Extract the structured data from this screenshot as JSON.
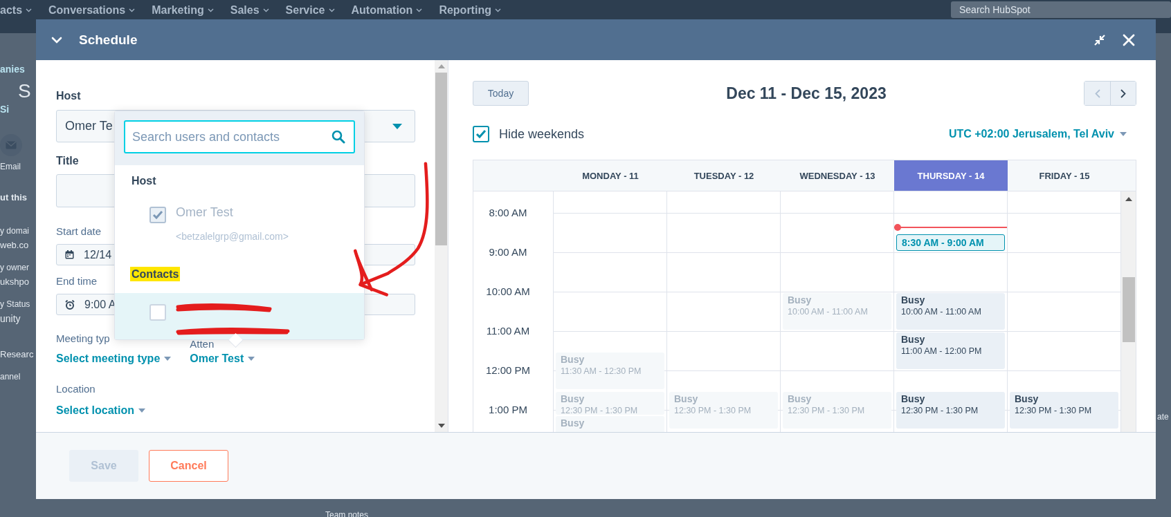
{
  "background": {
    "nav_items": [
      "acts",
      "Conversations",
      "Marketing",
      "Sales",
      "Service",
      "Automation",
      "Reporting"
    ],
    "search": {
      "placeholder": "Search HubSpot"
    },
    "left_items": [
      {
        "kind": "link",
        "text": "anies"
      },
      {
        "kind": "big",
        "text": "S"
      },
      {
        "kind": "link",
        "text": "Si"
      },
      {
        "kind": "email-icon"
      },
      {
        "kind": "label",
        "text": "Email"
      },
      {
        "kind": "heading",
        "text": "ut this"
      },
      {
        "kind": "label",
        "text": "y domai"
      },
      {
        "kind": "value",
        "text": "web.co"
      },
      {
        "kind": "label",
        "text": "y owner"
      },
      {
        "kind": "value",
        "text": "ukshpo"
      },
      {
        "kind": "label",
        "text": "y Status"
      },
      {
        "kind": "select",
        "text": "unity"
      },
      {
        "kind": "value",
        "text": "Researc"
      },
      {
        "kind": "label",
        "text": "annel"
      }
    ],
    "right_items": [
      "ate"
    ],
    "bottom_items": [
      "Team notes"
    ]
  },
  "modal": {
    "title": "Schedule",
    "form": {
      "host": {
        "label": "Host",
        "value": "Omer Te"
      },
      "title": {
        "label": "Title"
      },
      "start_date": {
        "label": "Start date",
        "value": "12/14"
      },
      "end_time": {
        "label": "End time",
        "value": "9:00 A"
      },
      "meeting_type": {
        "label": "Meeting typ",
        "value": "Select meeting type"
      },
      "attendees": {
        "label": "Atten",
        "value": "Omer Test"
      },
      "location": {
        "label": "Location",
        "value": "Select location"
      }
    },
    "picker": {
      "search": {
        "placeholder": "Search users and contacts"
      },
      "sections": [
        {
          "heading": "Host",
          "highlighted": false,
          "items": [
            {
              "name": "Omer Test",
              "email": "<betzalelgrp@gmail.com>",
              "checked": true,
              "disabled": true,
              "hovered": false,
              "redacted": false
            }
          ]
        },
        {
          "heading": "Contacts",
          "highlighted": true,
          "items": [
            {
              "checked": false,
              "disabled": false,
              "hovered": true,
              "redacted": true
            }
          ]
        }
      ]
    },
    "calendar": {
      "today_button": "Today",
      "range": "Dec 11 - Dec 15, 2023",
      "hide_weekends": {
        "label": "Hide weekends",
        "checked": true
      },
      "timezone": "UTC +02:00 Jerusalem, Tel Aviv",
      "hours": [
        "8:00 AM",
        "9:00 AM",
        "10:00 AM",
        "11:00 AM",
        "12:00 PM",
        "1:00 PM"
      ],
      "days": [
        {
          "label": "MONDAY - 11",
          "selected": false,
          "events": [
            {
              "kind": "busy",
              "title": "Busy",
              "time": "11:30 AM - 12:30 PM",
              "faded": true
            },
            {
              "kind": "busy",
              "title": "Busy",
              "time": "12:30 PM - 1:30 PM",
              "faded": true
            },
            {
              "kind": "busy",
              "title": "Busy",
              "faded": true
            }
          ]
        },
        {
          "label": "TUESDAY - 12",
          "selected": false,
          "events": [
            {
              "kind": "busy",
              "title": "Busy",
              "time": "12:30 PM - 1:30 PM",
              "faded": true
            }
          ]
        },
        {
          "label": "WEDNESDAY - 13",
          "selected": false,
          "events": [
            {
              "kind": "busy",
              "title": "Busy",
              "time": "10:00 AM - 11:00 AM",
              "faded": true
            },
            {
              "kind": "busy",
              "title": "Busy",
              "time": "12:30 PM - 1:30 PM",
              "faded": true
            }
          ]
        },
        {
          "label": "THURSDAY - 14",
          "selected": true,
          "events": [
            {
              "kind": "proposed",
              "time": "8:30 AM - 9:00 AM"
            },
            {
              "kind": "busy",
              "title": "Busy",
              "time": "10:00 AM - 11:00 AM",
              "faded": false
            },
            {
              "kind": "busy",
              "title": "Busy",
              "time": "11:00 AM - 12:00 PM",
              "faded": false
            },
            {
              "kind": "busy",
              "title": "Busy",
              "time": "12:30 PM - 1:30 PM",
              "faded": false
            }
          ]
        },
        {
          "label": "FRIDAY - 15",
          "selected": false,
          "events": [
            {
              "kind": "busy",
              "title": "Busy",
              "time": "12:30 PM - 1:30 PM",
              "faded": false
            }
          ]
        }
      ]
    },
    "footer": {
      "buttons": [
        {
          "label": "Save",
          "kind": "primary",
          "disabled": true
        },
        {
          "label": "Cancel",
          "kind": "secondary",
          "disabled": false
        }
      ]
    }
  }
}
